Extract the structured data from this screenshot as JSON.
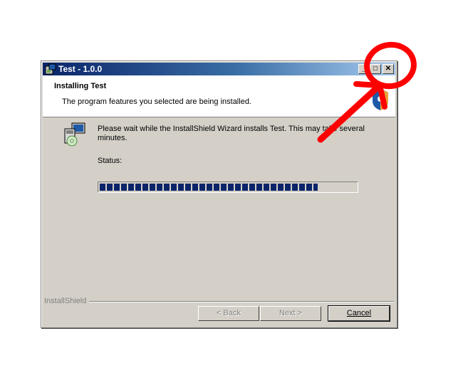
{
  "window": {
    "title": "Test - 1.0.0",
    "controls": {
      "minimize": "_",
      "maximize": "□",
      "close": "✕"
    }
  },
  "header": {
    "title": "Installing Test",
    "subtitle": "The program features you selected are being installed."
  },
  "body": {
    "message": "Please wait while the InstallShield Wizard installs Test. This may take several minutes.",
    "status_label": "Status:",
    "progress_fraction": 0.85
  },
  "footer": {
    "brand": "InstallShield",
    "back_label": "< Back",
    "next_label": "Next >",
    "cancel_label": "Cancel"
  },
  "colors": {
    "title_bar_start": "#0a246a",
    "progress": "#0a246a",
    "annotation": "#ff0000"
  },
  "icons": [
    "installer-icon",
    "install-package-icon",
    "installshield-logo-icon"
  ]
}
